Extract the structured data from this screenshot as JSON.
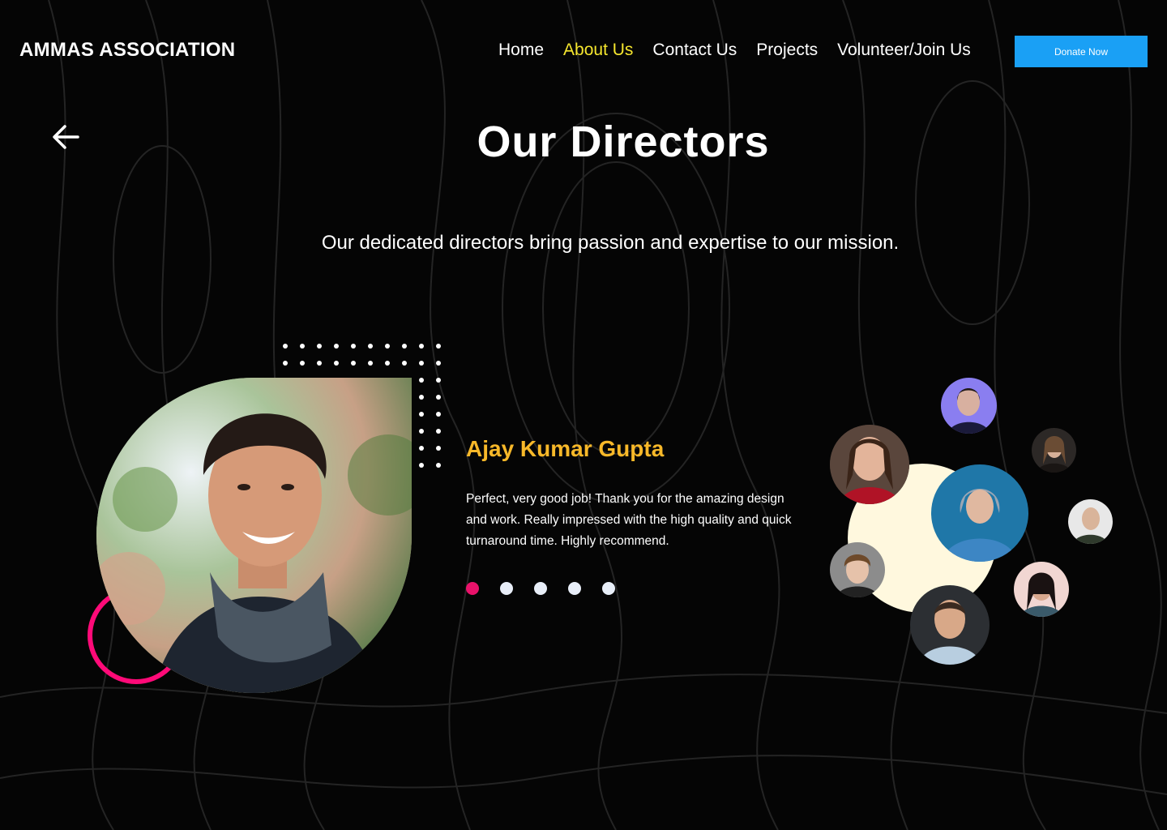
{
  "header": {
    "brand": "AMMAS ASSOCIATION",
    "nav": [
      {
        "label": "Home",
        "active": false
      },
      {
        "label": "About Us",
        "active": true
      },
      {
        "label": "Contact Us",
        "active": false
      },
      {
        "label": "Projects",
        "active": false
      },
      {
        "label": "Volunteer/Join Us",
        "active": false
      }
    ],
    "donate_label": "Donate Now"
  },
  "page": {
    "back_icon": "arrow-left-icon",
    "title": "Our Directors",
    "subtitle": "Our dedicated directors bring passion and expertise to our mission."
  },
  "featured": {
    "name": "Ajay Kumar Gupta",
    "quote": "Perfect, very good job! Thank you for the amazing design and work. Really impressed with the high quality and quick turnaround time. Highly recommend.",
    "slide_count": 5,
    "active_slide": 1
  },
  "colors": {
    "background": "#050505",
    "nav_active": "#f5e62e",
    "donate": "#1aa0f5",
    "name": "#f7b829",
    "accent_pink": "#ff0a78",
    "cream": "#fff8de"
  }
}
